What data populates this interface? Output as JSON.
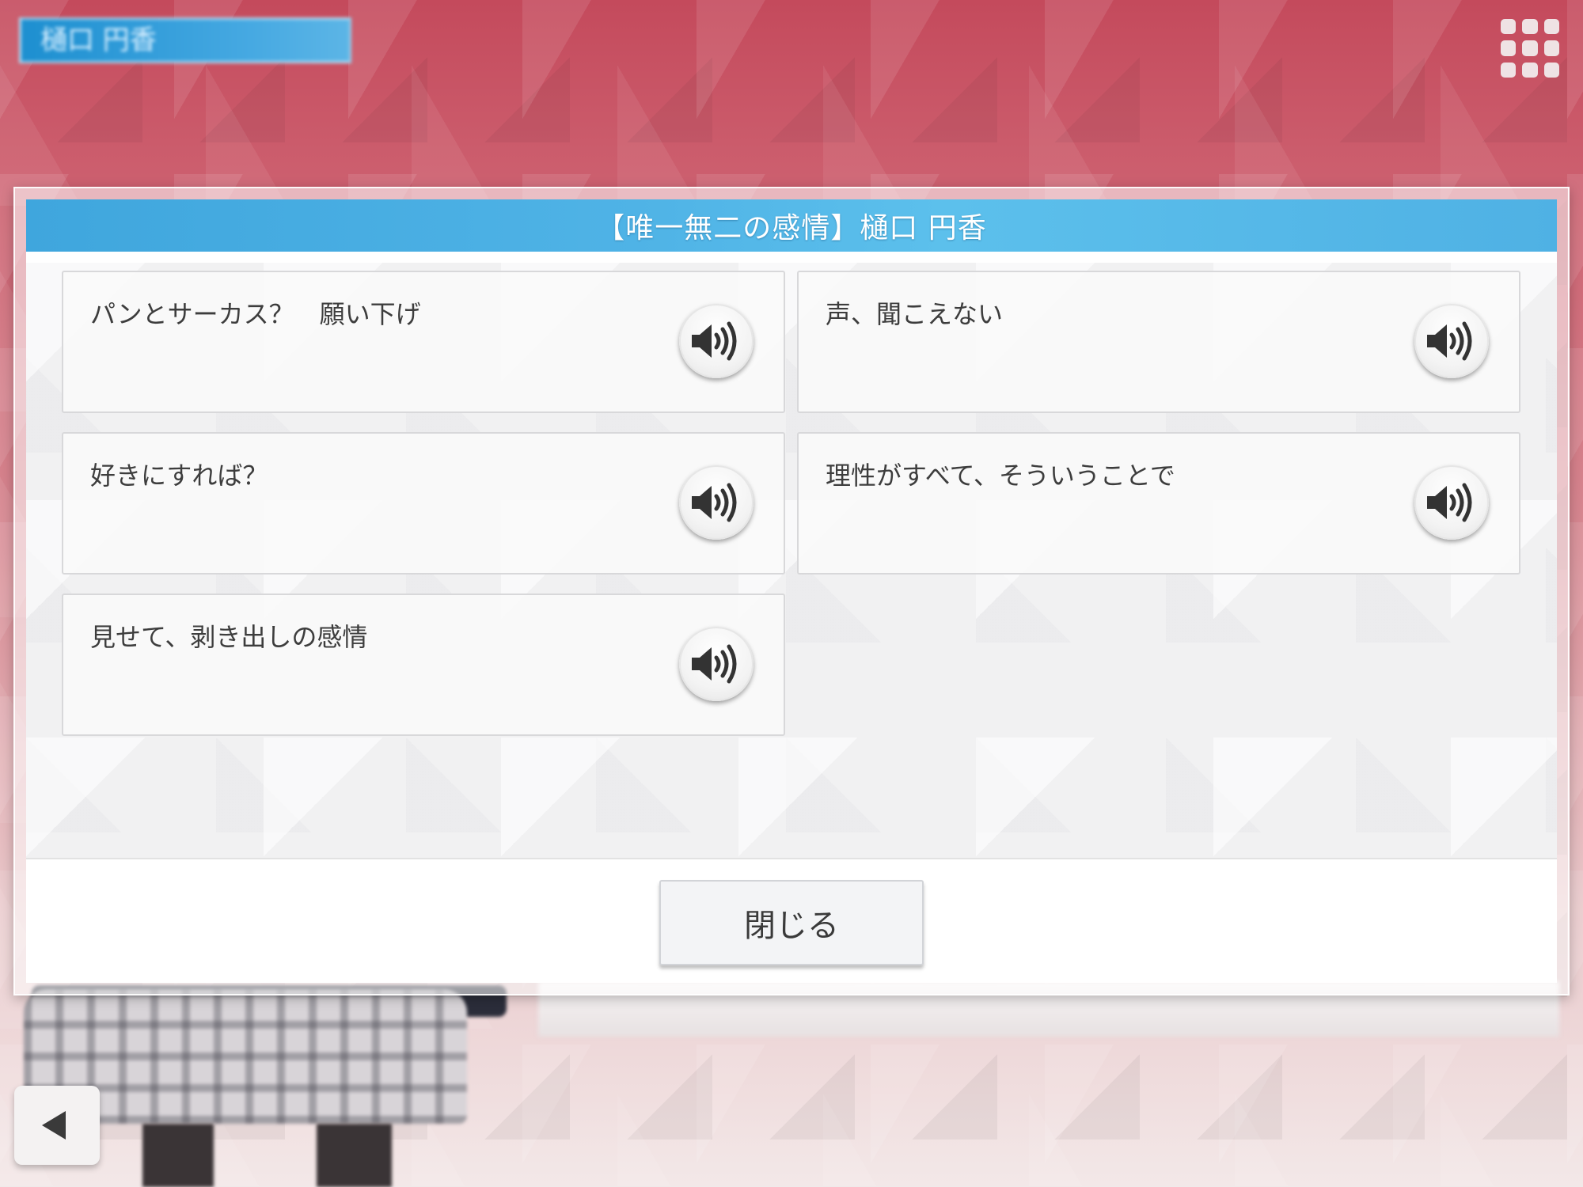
{
  "top_bar": {
    "name_plate": "樋口 円香",
    "menu_icon": "grid-menu-icon"
  },
  "modal": {
    "title": "【唯一無二の感情】樋口 円香",
    "voices": [
      {
        "label": "パンとサーカス？　願い下げ",
        "icon": "speaker-icon"
      },
      {
        "label": "声、聞こえない",
        "icon": "speaker-icon"
      },
      {
        "label": "好きにすれば？",
        "icon": "speaker-icon"
      },
      {
        "label": "理性がすべて、そういうことで",
        "icon": "speaker-icon"
      },
      {
        "label": "見せて、剥き出しの感情",
        "icon": "speaker-icon"
      }
    ],
    "close_label": "閉じる"
  },
  "colors": {
    "header_blue": "#4fb3e6",
    "background_red": "#c44a5c",
    "text_dark": "#3d3d3d"
  }
}
